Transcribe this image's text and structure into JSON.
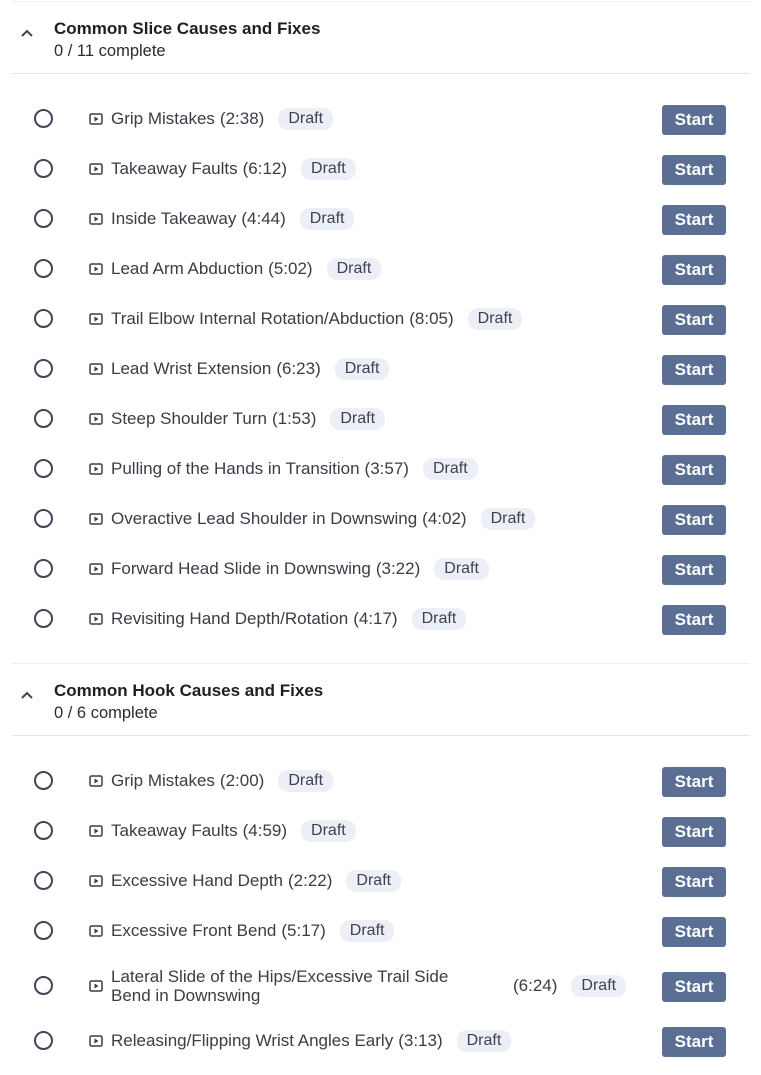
{
  "sections": [
    {
      "title": "Common Slice Causes and Fixes",
      "progress": "0 / 11 complete",
      "lessons": [
        {
          "title": "Grip Mistakes",
          "duration": "(2:38)",
          "status": "Draft",
          "action": "Start"
        },
        {
          "title": "Takeaway Faults",
          "duration": "(6:12)",
          "status": "Draft",
          "action": "Start"
        },
        {
          "title": "Inside Takeaway",
          "duration": "(4:44)",
          "status": "Draft",
          "action": "Start"
        },
        {
          "title": "Lead Arm Abduction",
          "duration": "(5:02)",
          "status": "Draft",
          "action": "Start"
        },
        {
          "title": "Trail Elbow Internal Rotation/Abduction",
          "duration": "(8:05)",
          "status": "Draft",
          "action": "Start"
        },
        {
          "title": "Lead Wrist Extension",
          "duration": "(6:23)",
          "status": "Draft",
          "action": "Start"
        },
        {
          "title": "Steep Shoulder Turn",
          "duration": "(1:53)",
          "status": "Draft",
          "action": "Start"
        },
        {
          "title": "Pulling of the Hands in Transition",
          "duration": "(3:57)",
          "status": "Draft",
          "action": "Start"
        },
        {
          "title": "Overactive Lead Shoulder in Downswing",
          "duration": "(4:02)",
          "status": "Draft",
          "action": "Start"
        },
        {
          "title": "Forward Head Slide in Downswing",
          "duration": "(3:22)",
          "status": "Draft",
          "action": "Start"
        },
        {
          "title": "Revisiting Hand Depth/Rotation",
          "duration": "(4:17)",
          "status": "Draft",
          "action": "Start"
        }
      ]
    },
    {
      "title": "Common Hook Causes and Fixes",
      "progress": "0 / 6 complete",
      "lessons": [
        {
          "title": "Grip Mistakes",
          "duration": "(2:00)",
          "status": "Draft",
          "action": "Start"
        },
        {
          "title": "Takeaway Faults",
          "duration": "(4:59)",
          "status": "Draft",
          "action": "Start"
        },
        {
          "title": "Excessive Hand Depth",
          "duration": "(2:22)",
          "status": "Draft",
          "action": "Start"
        },
        {
          "title": "Excessive Front Bend",
          "duration": "(5:17)",
          "status": "Draft",
          "action": "Start"
        },
        {
          "title": "Lateral Slide of the Hips/Excessive Trail Side Bend in Downswing",
          "duration": "(6:24)",
          "status": "Draft",
          "action": "Start"
        },
        {
          "title": "Releasing/Flipping Wrist Angles Early",
          "duration": "(3:13)",
          "status": "Draft",
          "action": "Start"
        }
      ]
    }
  ],
  "icons": {
    "collapse": "chevron-up-icon",
    "complete_toggle": "circle-outline-icon",
    "lesson_type": "video-lesson-icon"
  },
  "colors": {
    "start_button": "#5a6f93",
    "draft_badge_bg": "#eceff5",
    "divider": "#e3e5ea"
  }
}
